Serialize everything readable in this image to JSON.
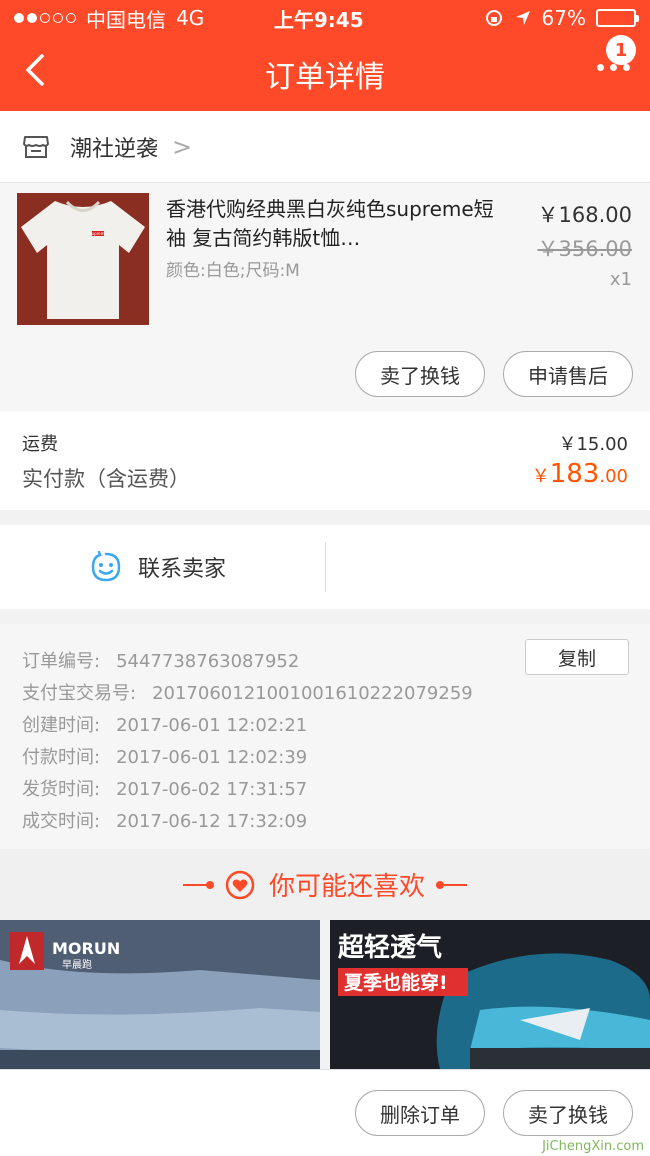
{
  "status": {
    "carrier": "中国电信",
    "network": "4G",
    "time": "上午9:45",
    "battery": "67%",
    "battery_level": 0.67
  },
  "header": {
    "title": "订单详情",
    "badge": "1"
  },
  "shop": {
    "name": "潮社逆袭",
    "arrow": ">"
  },
  "product": {
    "title": "香港代购经典黑白灰纯色supreme短袖 复古简约韩版t恤…",
    "spec": "颜色:白色;尺码:M",
    "price": "￥168.00",
    "original_price": "￥356.00",
    "qty": "x1",
    "logo_text": "Supreme",
    "btn_sell": "卖了换钱",
    "btn_after_sale": "申请售后"
  },
  "fees": {
    "shipping_label": "运费",
    "shipping_value": "￥15.00",
    "paid_label": "实付款（含运费）",
    "paid_symbol": "￥",
    "paid_int": "183",
    "paid_dec": ".00"
  },
  "contact": {
    "label": "联系卖家"
  },
  "order": {
    "copy_label": "复制",
    "rows": [
      {
        "k": "订单编号:",
        "v": "5447738763087952"
      },
      {
        "k": "支付宝交易号:",
        "v": "2017060121001001610222079259"
      },
      {
        "k": "创建时间:",
        "v": "2017-06-01 12:02:21"
      },
      {
        "k": "付款时间:",
        "v": "2017-06-01 12:02:39"
      },
      {
        "k": "发货时间:",
        "v": "2017-06-02 17:31:57"
      },
      {
        "k": "成交时间:",
        "v": "2017-06-12 17:32:09"
      }
    ]
  },
  "recommend": {
    "title": "你可能还喜欢",
    "card1_brand": "MORUN",
    "card1_sub": "早晨跑",
    "card2_title": "超轻透气",
    "card2_sub": "夏季也能穿!"
  },
  "bottom": {
    "delete_label": "删除订单",
    "sell_label": "卖了换钱"
  },
  "watermark": "JiChengXin.com",
  "colors": {
    "accent": "#ff4a2a",
    "price_highlight": "#ff5500"
  }
}
